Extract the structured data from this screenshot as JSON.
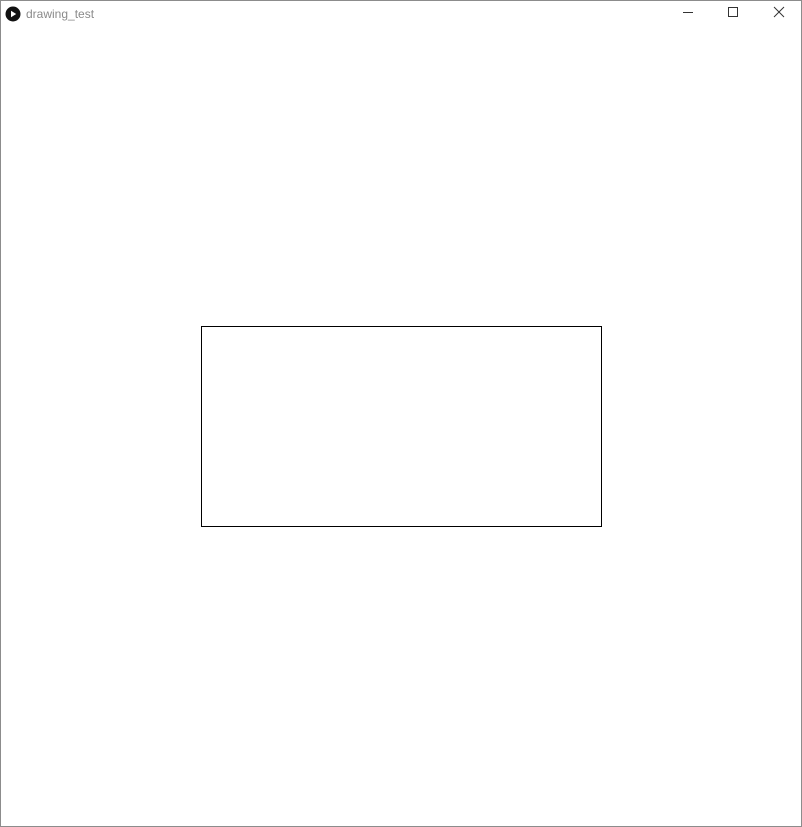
{
  "window": {
    "title": "drawing_test",
    "app_icon": "play-circle-icon",
    "controls": {
      "minimize_icon": "minimize-icon",
      "maximize_icon": "maximize-icon",
      "close_icon": "close-icon"
    }
  },
  "canvas": {
    "background": "#ffffff",
    "shapes": [
      {
        "type": "rectangle",
        "stroke": "#000000",
        "fill": "#ffffff"
      }
    ]
  }
}
